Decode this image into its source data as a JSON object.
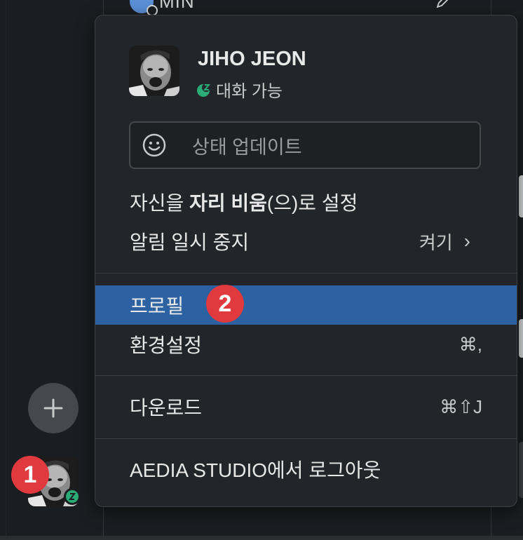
{
  "background": {
    "dm_name": "MIN"
  },
  "menu": {
    "user": {
      "name": "JIHO JEON",
      "status": "대화 가능"
    },
    "status_placeholder": "상태 업데이트",
    "away": {
      "prefix": "자신을 ",
      "bold": "자리 비움",
      "suffix": "(으)로 설정"
    },
    "pause_notifications": {
      "label": "알림 일시 중지",
      "value": "켜기",
      "chevron": "›"
    },
    "profile": {
      "label": "프로필"
    },
    "preferences": {
      "label": "환경설정",
      "shortcut": "⌘,"
    },
    "download": {
      "label": "다운로드",
      "shortcut": "⌘⇧J"
    },
    "logout": {
      "label": "AEDIA STUDIO에서 로그아웃"
    }
  },
  "badges": {
    "one": "1",
    "two": "2"
  },
  "colors": {
    "accent_highlight": "#2c62a1",
    "badge": "#e0393e",
    "status_green": "#2bac76"
  }
}
